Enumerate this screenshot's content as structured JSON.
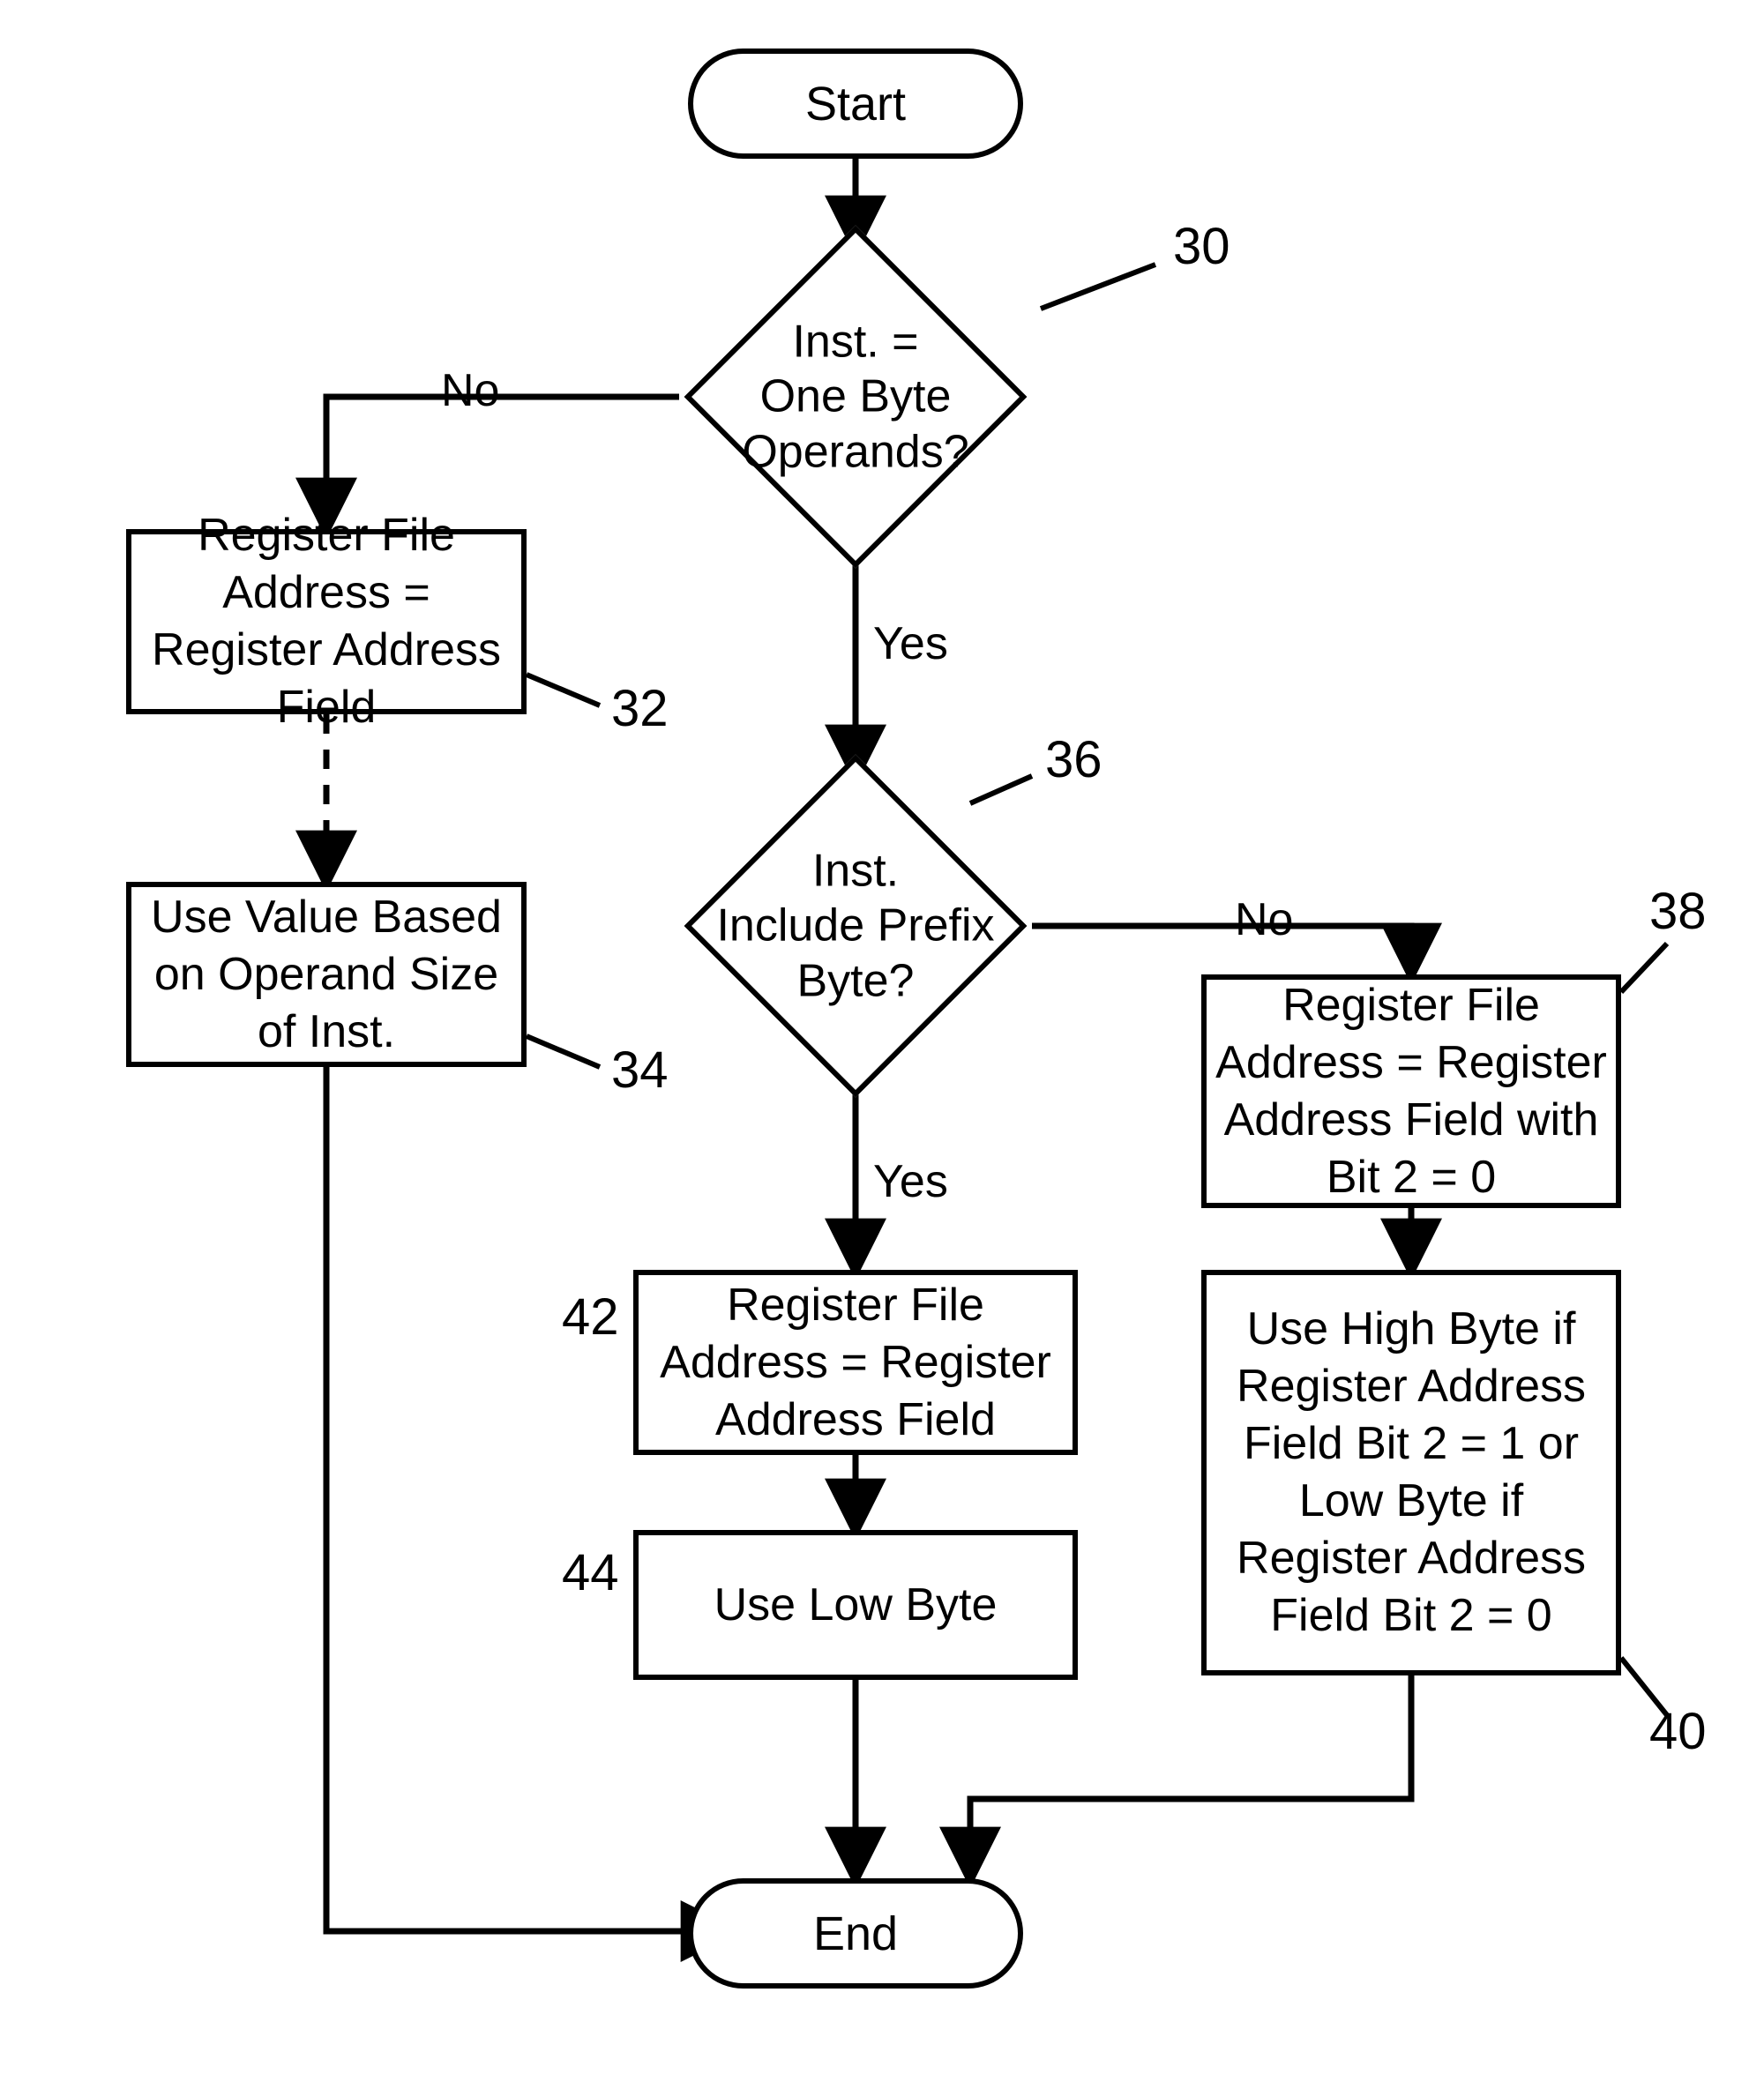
{
  "chart_data": {
    "type": "flowchart",
    "title": "",
    "nodes": [
      {
        "id": "start",
        "kind": "terminator",
        "text": "Start"
      },
      {
        "id": "d30",
        "kind": "decision",
        "text": "Inst. = One Byte Operands?",
        "ref": "30"
      },
      {
        "id": "p32",
        "kind": "process",
        "text": "Register File Address = Register Address Field",
        "ref": "32"
      },
      {
        "id": "p34",
        "kind": "process",
        "text": "Use Value Based on Operand Size of Inst.",
        "ref": "34"
      },
      {
        "id": "d36",
        "kind": "decision",
        "text": "Inst. Include Prefix Byte?",
        "ref": "36"
      },
      {
        "id": "p38",
        "kind": "process",
        "text": "Register File Address = Register Address Field with Bit 2 = 0",
        "ref": "38"
      },
      {
        "id": "p40",
        "kind": "process",
        "text": "Use High Byte if Register Address Field Bit 2 = 1 or Low Byte if Register Address Field Bit 2 = 0",
        "ref": "40"
      },
      {
        "id": "p42",
        "kind": "process",
        "text": "Register File Address = Register Address Field",
        "ref": "42"
      },
      {
        "id": "p44",
        "kind": "process",
        "text": "Use Low Byte",
        "ref": "44"
      },
      {
        "id": "end",
        "kind": "terminator",
        "text": "End"
      }
    ],
    "edges": [
      {
        "from": "start",
        "to": "d30",
        "label": ""
      },
      {
        "from": "d30",
        "to": "p32",
        "label": "No"
      },
      {
        "from": "d30",
        "to": "d36",
        "label": "Yes"
      },
      {
        "from": "p32",
        "to": "p34",
        "label": "",
        "style": "dashed"
      },
      {
        "from": "p34",
        "to": "end",
        "label": ""
      },
      {
        "from": "d36",
        "to": "p42",
        "label": "Yes"
      },
      {
        "from": "d36",
        "to": "p38",
        "label": "No"
      },
      {
        "from": "p42",
        "to": "p44",
        "label": ""
      },
      {
        "from": "p44",
        "to": "end",
        "label": ""
      },
      {
        "from": "p38",
        "to": "p40",
        "label": "",
        "style": "dashed"
      },
      {
        "from": "p40",
        "to": "end",
        "label": ""
      }
    ]
  },
  "labels": {
    "start": "Start",
    "end": "End",
    "d30": "Inst. =\nOne Byte\nOperands?",
    "d36": "Inst.\nInclude Prefix\nByte?",
    "p32": "Register File Address = Register Address Field",
    "p34": "Use Value Based on Operand Size of Inst.",
    "p38": "Register File Address = Register Address Field with Bit 2 = 0",
    "p40": "Use High Byte if Register Address Field Bit 2 = 1 or Low Byte if Register Address Field Bit 2 = 0",
    "p42": "Register File Address = Register Address Field",
    "p44": "Use Low Byte",
    "no": "No",
    "yes": "Yes",
    "r30": "30",
    "r32": "32",
    "r34": "34",
    "r36": "36",
    "r38": "38",
    "r40": "40",
    "r42": "42",
    "r44": "44"
  }
}
